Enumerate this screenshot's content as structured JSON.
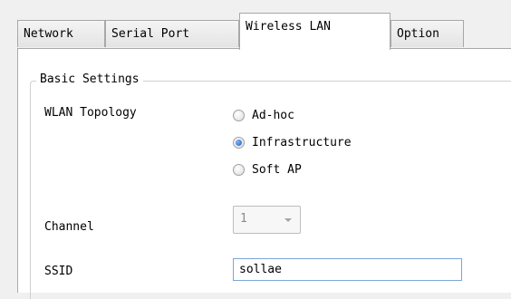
{
  "tabs": [
    {
      "label": "Network",
      "active": false
    },
    {
      "label": "Serial Port",
      "active": false
    },
    {
      "label": "Wireless LAN",
      "active": true
    },
    {
      "label": "Option",
      "active": false
    }
  ],
  "basic_settings": {
    "title": "Basic Settings",
    "wlan_topology": {
      "label": "WLAN Topology",
      "options": [
        {
          "label": "Ad-hoc",
          "checked": false
        },
        {
          "label": "Infrastructure",
          "checked": true
        },
        {
          "label": "Soft AP",
          "checked": false
        }
      ]
    },
    "channel": {
      "label": "Channel",
      "value": "1",
      "disabled": true
    },
    "ssid": {
      "label": "SSID",
      "value": "sollae"
    }
  },
  "colors": {
    "window_background": "#f0f0f0",
    "panel_background": "#ffffff",
    "tab_border": "#a8a8a8",
    "radio_selected": "#1f5fbf",
    "input_focus_border": "#7aa7d8"
  }
}
